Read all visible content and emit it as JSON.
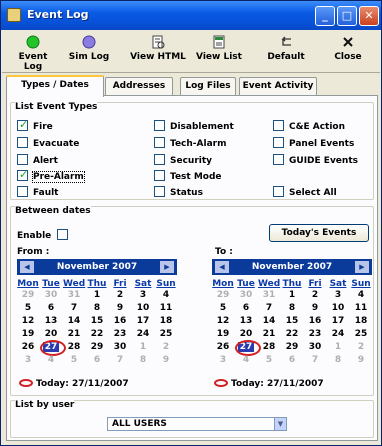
{
  "window": {
    "title": "Event Log"
  },
  "toolbar": {
    "items": [
      {
        "label": "Event Log",
        "icon": "event-log-icon"
      },
      {
        "label": "Sim Log",
        "icon": "sim-log-icon"
      },
      {
        "label": "View HTML",
        "icon": "view-html-icon"
      },
      {
        "label": "View List",
        "icon": "view-list-icon"
      },
      {
        "label": "Default",
        "icon": "default-icon"
      },
      {
        "label": "Close",
        "icon": "close-icon"
      }
    ]
  },
  "tabs": [
    "Types / Dates",
    "Addresses",
    "Log Files",
    "Event Activity"
  ],
  "event_types": {
    "title": "List Event Types",
    "items": [
      {
        "label": "Fire",
        "checked": true
      },
      {
        "label": "Evacuate",
        "checked": false
      },
      {
        "label": "Alert",
        "checked": false
      },
      {
        "label": "Pre-Alarm",
        "checked": true
      },
      {
        "label": "Fault",
        "checked": false
      },
      {
        "label": "Disablement",
        "checked": false
      },
      {
        "label": "Tech-Alarm",
        "checked": false
      },
      {
        "label": "Security",
        "checked": false
      },
      {
        "label": "Test Mode",
        "checked": false
      },
      {
        "label": "Status",
        "checked": false
      },
      {
        "label": "C&E Action",
        "checked": false
      },
      {
        "label": "Panel Events",
        "checked": false
      },
      {
        "label": "GUIDE Events",
        "checked": false
      },
      {
        "label": "Select All",
        "checked": false
      }
    ]
  },
  "dates": {
    "title": "Between dates",
    "enable_label": "Enable",
    "today_events_label": "Today's Events",
    "from_label": "From :",
    "to_label": "To :",
    "month": "November 2007",
    "day_names": [
      "Mon",
      "Tue",
      "Wed",
      "Thu",
      "Fri",
      "Sat",
      "Sun"
    ],
    "weeks": [
      [
        "29",
        "30",
        "31",
        "1",
        "2",
        "3",
        "4"
      ],
      [
        "5",
        "6",
        "7",
        "8",
        "9",
        "10",
        "11"
      ],
      [
        "12",
        "13",
        "14",
        "15",
        "16",
        "17",
        "18"
      ],
      [
        "19",
        "20",
        "21",
        "22",
        "23",
        "24",
        "25"
      ],
      [
        "26",
        "27",
        "28",
        "29",
        "30",
        "1",
        "2"
      ],
      [
        "3",
        "4",
        "5",
        "6",
        "7",
        "8",
        "9"
      ]
    ],
    "today_text": "Today: 27/11/2007"
  },
  "users": {
    "title": "List by user",
    "selected": "ALL USERS"
  }
}
